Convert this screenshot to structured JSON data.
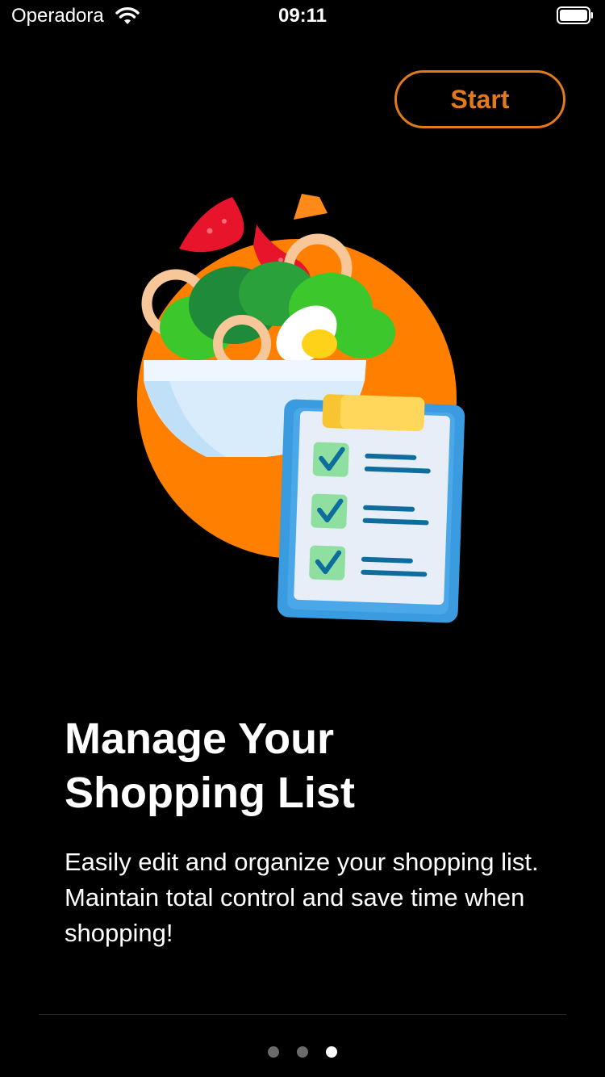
{
  "status_bar": {
    "carrier": "Operadora",
    "time": "09:11"
  },
  "header": {
    "start_label": "Start"
  },
  "illustration": {
    "icon": "salad-bowl-checklist-illustration",
    "accent_color": "#ff7f00"
  },
  "content": {
    "title": "Manage Your\nShopping List",
    "description": "Easily edit and organize your shopping list. Maintain total control and save time when shopping!"
  },
  "pager": {
    "page_count": 3,
    "current_page": 3
  },
  "colors": {
    "background": "#000000",
    "accent": "#e07a1a",
    "dot_inactive": "#6b6b6b",
    "dot_active": "#ffffff"
  }
}
